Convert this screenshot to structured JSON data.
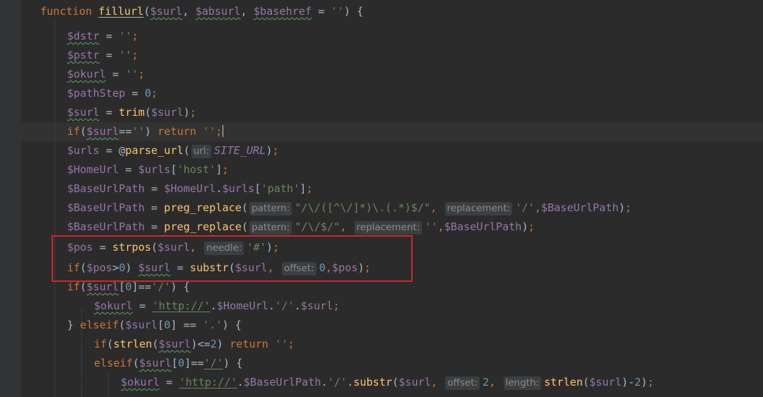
{
  "colors": {
    "background": "#2b2b2b",
    "keyword": "#cc7832",
    "function": "#ffc66d",
    "variable": "#9876aa",
    "string": "#6a8759",
    "number": "#6897bb",
    "highlight_box": "#d32626"
  },
  "editor": {
    "caret_line": 7,
    "highlight_box": {
      "label": "red-annotation-box",
      "covers_lines": [
        13,
        14
      ]
    },
    "lines": [
      [
        [
          "kw",
          "function "
        ],
        [
          "fn",
          "fillurl"
        ],
        [
          "op",
          "("
        ],
        [
          "var",
          "$surl"
        ],
        [
          "op",
          ", "
        ],
        [
          "var",
          "$absurl"
        ],
        [
          "op",
          ", "
        ],
        [
          "var",
          "$basehref"
        ],
        [
          "op",
          " = "
        ],
        [
          "str",
          "''"
        ],
        [
          "op",
          ") {"
        ]
      ],
      [
        [
          "var",
          "$dstr"
        ],
        [
          "op",
          " = "
        ],
        [
          "str",
          "''"
        ],
        [
          "kw",
          ";"
        ]
      ],
      [
        [
          "var",
          "$pstr"
        ],
        [
          "op",
          " = "
        ],
        [
          "str",
          "''"
        ],
        [
          "kw",
          ";"
        ]
      ],
      [
        [
          "var",
          "$okurl"
        ],
        [
          "op",
          " = "
        ],
        [
          "str",
          "''"
        ],
        [
          "kw",
          ";"
        ]
      ],
      [
        [
          "var",
          "$pathStep"
        ],
        [
          "op",
          " = "
        ],
        [
          "num",
          "0"
        ],
        [
          "kw",
          ";"
        ]
      ],
      [
        [
          "var",
          "$surl"
        ],
        [
          "op",
          " = "
        ],
        [
          "fn",
          "trim"
        ],
        [
          "op",
          "("
        ],
        [
          "var",
          "$surl"
        ],
        [
          "op",
          ")"
        ],
        [
          "kw",
          ";"
        ]
      ],
      [
        [
          "kw",
          "if"
        ],
        [
          "op",
          "("
        ],
        [
          "var",
          "$surl"
        ],
        [
          "op",
          "=="
        ],
        [
          "str",
          "''"
        ],
        [
          "op",
          ") "
        ],
        [
          "kw",
          "return "
        ],
        [
          "str",
          "''"
        ],
        [
          "kw",
          ";"
        ]
      ],
      [
        [
          "var",
          "$urls"
        ],
        [
          "op",
          " = @"
        ],
        [
          "fn",
          "parse_url"
        ],
        [
          "op",
          "("
        ],
        [
          "hint",
          "url:"
        ],
        [
          "const",
          "SITE_URL"
        ],
        [
          "op",
          ")"
        ],
        [
          "kw",
          ";"
        ]
      ],
      [
        [
          "var",
          "$HomeUrl"
        ],
        [
          "op",
          " = "
        ],
        [
          "var",
          "$urls"
        ],
        [
          "op",
          "["
        ],
        [
          "str",
          "'host'"
        ],
        [
          "op",
          "]"
        ],
        [
          "kw",
          ";"
        ]
      ],
      [
        [
          "var",
          "$BaseUrlPath"
        ],
        [
          "op",
          " = "
        ],
        [
          "var",
          "$HomeUrl"
        ],
        [
          "op",
          "."
        ],
        [
          "var",
          "$urls"
        ],
        [
          "op",
          "["
        ],
        [
          "str",
          "'path'"
        ],
        [
          "op",
          "]"
        ],
        [
          "kw",
          ";"
        ]
      ],
      [
        [
          "var",
          "$BaseUrlPath"
        ],
        [
          "op",
          " = "
        ],
        [
          "fn",
          "preg_replace"
        ],
        [
          "op",
          "("
        ],
        [
          "hint",
          "pattern:"
        ],
        [
          "str",
          "\"/\\/([^\\/]*)\\.(.*)$/\""
        ],
        [
          "kw",
          ", "
        ],
        [
          "hint",
          "replacement:"
        ],
        [
          "str",
          "'/'"
        ],
        [
          "kw",
          ","
        ],
        [
          "var",
          "$BaseUrlPath"
        ],
        [
          "op",
          ")"
        ],
        [
          "kw",
          ";"
        ]
      ],
      [
        [
          "var",
          "$BaseUrlPath"
        ],
        [
          "op",
          " = "
        ],
        [
          "fn",
          "preg_replace"
        ],
        [
          "op",
          "("
        ],
        [
          "hint",
          "pattern:"
        ],
        [
          "str",
          "\"/\\/$/\""
        ],
        [
          "kw",
          ", "
        ],
        [
          "hint",
          "replacement:"
        ],
        [
          "str",
          "''"
        ],
        [
          "kw",
          ","
        ],
        [
          "var",
          "$BaseUrlPath"
        ],
        [
          "op",
          ")"
        ],
        [
          "kw",
          ";"
        ]
      ],
      [
        [
          "var",
          "$pos"
        ],
        [
          "op",
          " = "
        ],
        [
          "fn",
          "strpos"
        ],
        [
          "op",
          "("
        ],
        [
          "var",
          "$surl"
        ],
        [
          "kw",
          ", "
        ],
        [
          "hint",
          "needle:"
        ],
        [
          "str",
          "'#'"
        ],
        [
          "op",
          ")"
        ],
        [
          "kw",
          ";"
        ]
      ],
      [
        [
          "kw",
          "if"
        ],
        [
          "op",
          "("
        ],
        [
          "var",
          "$pos"
        ],
        [
          "op",
          ">"
        ],
        [
          "num",
          "0"
        ],
        [
          "op",
          ") "
        ],
        [
          "var",
          "$surl"
        ],
        [
          "op",
          " = "
        ],
        [
          "fn",
          "substr"
        ],
        [
          "op",
          "("
        ],
        [
          "var",
          "$surl"
        ],
        [
          "kw",
          ", "
        ],
        [
          "hint",
          "offset:"
        ],
        [
          "num",
          "0"
        ],
        [
          "kw",
          ","
        ],
        [
          "var",
          "$pos"
        ],
        [
          "op",
          ")"
        ],
        [
          "kw",
          ";"
        ]
      ],
      [
        [
          "kw",
          "if"
        ],
        [
          "op",
          "("
        ],
        [
          "var",
          "$surl"
        ],
        [
          "op",
          "["
        ],
        [
          "num",
          "0"
        ],
        [
          "op",
          "]=="
        ],
        [
          "str",
          "'/'"
        ],
        [
          "op",
          ") {"
        ]
      ],
      [
        [
          "var",
          "$okurl"
        ],
        [
          "op",
          " = "
        ],
        [
          "str",
          "'http://'"
        ],
        [
          "op",
          "."
        ],
        [
          "var",
          "$HomeUrl"
        ],
        [
          "op",
          "."
        ],
        [
          "str",
          "'/'"
        ],
        [
          "op",
          "."
        ],
        [
          "var",
          "$surl"
        ],
        [
          "kw",
          ";"
        ]
      ],
      [
        [
          "op",
          "} "
        ],
        [
          "kw",
          "elseif"
        ],
        [
          "op",
          "("
        ],
        [
          "var",
          "$surl"
        ],
        [
          "op",
          "["
        ],
        [
          "num",
          "0"
        ],
        [
          "op",
          "] == "
        ],
        [
          "str",
          "'.'"
        ],
        [
          "op",
          ") {"
        ]
      ],
      [
        [
          "kw",
          "if"
        ],
        [
          "op",
          "("
        ],
        [
          "fn",
          "strlen"
        ],
        [
          "op",
          "("
        ],
        [
          "var",
          "$surl"
        ],
        [
          "op",
          ")<="
        ],
        [
          "num",
          "2"
        ],
        [
          "op",
          ") "
        ],
        [
          "kw",
          "return "
        ],
        [
          "str",
          "''"
        ],
        [
          "kw",
          ";"
        ]
      ],
      [
        [
          "kw",
          "elseif"
        ],
        [
          "op",
          "("
        ],
        [
          "var",
          "$surl"
        ],
        [
          "op",
          "["
        ],
        [
          "num",
          "0"
        ],
        [
          "op",
          "]=="
        ],
        [
          "str",
          "'/'"
        ],
        [
          "op",
          ") {"
        ]
      ],
      [
        [
          "var",
          "$okurl"
        ],
        [
          "op",
          " = "
        ],
        [
          "str",
          "'http://'"
        ],
        [
          "op",
          "."
        ],
        [
          "var",
          "$BaseUrlPath"
        ],
        [
          "op",
          "."
        ],
        [
          "str",
          "'/'"
        ],
        [
          "op",
          "."
        ],
        [
          "fn",
          "substr"
        ],
        [
          "op",
          "("
        ],
        [
          "var",
          "$surl"
        ],
        [
          "kw",
          ", "
        ],
        [
          "hint",
          "offset:"
        ],
        [
          "num",
          "2"
        ],
        [
          "kw",
          ", "
        ],
        [
          "hint",
          "length:"
        ],
        [
          "fn",
          "strlen"
        ],
        [
          "op",
          "("
        ],
        [
          "var",
          "$surl"
        ],
        [
          "op",
          ")-"
        ],
        [
          "num",
          "2"
        ],
        [
          "op",
          ")"
        ],
        [
          "kw",
          ";"
        ]
      ]
    ]
  }
}
